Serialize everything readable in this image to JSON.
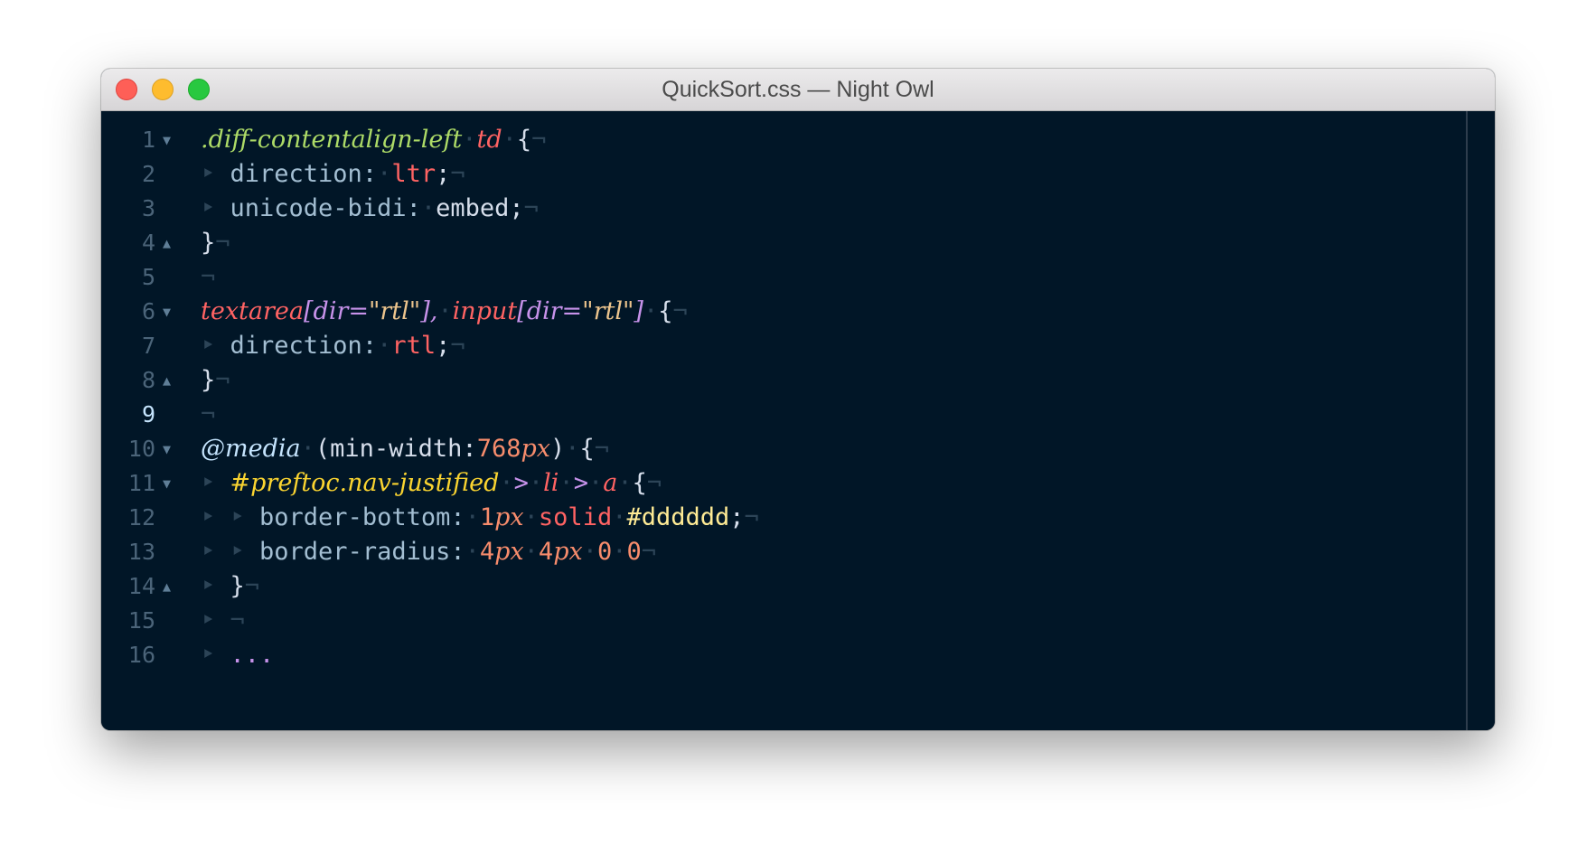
{
  "window": {
    "title": "QuickSort.css — Night Owl"
  },
  "colors": {
    "background": "#011627",
    "selector": "#addb67",
    "tag": "#ff6363",
    "attribute": "#c792ea",
    "number": "#f78c6c",
    "id_selector": "#fad430",
    "hex": "#ffeb95",
    "invisibles": "#2c4457"
  },
  "invisibles": {
    "eol": "¬",
    "tab": "‣"
  },
  "gutter": {
    "lines": [
      {
        "num": "1",
        "fold": "▼"
      },
      {
        "num": "2",
        "fold": ""
      },
      {
        "num": "3",
        "fold": ""
      },
      {
        "num": "4",
        "fold": "▲"
      },
      {
        "num": "5",
        "fold": ""
      },
      {
        "num": "6",
        "fold": "▼"
      },
      {
        "num": "7",
        "fold": ""
      },
      {
        "num": "8",
        "fold": "▲"
      },
      {
        "num": "9",
        "fold": ""
      },
      {
        "num": "10",
        "fold": "▼"
      },
      {
        "num": "11",
        "fold": "▼"
      },
      {
        "num": "12",
        "fold": ""
      },
      {
        "num": "13",
        "fold": ""
      },
      {
        "num": "14",
        "fold": "▲"
      },
      {
        "num": "15",
        "fold": ""
      },
      {
        "num": "16",
        "fold": ""
      }
    ],
    "active_line": "9"
  },
  "code": [
    [
      {
        "t": "sel",
        "v": ".diff-contentalign-left"
      },
      {
        "t": "inv",
        "v": "·"
      },
      {
        "t": "tag",
        "v": "td"
      },
      {
        "t": "inv",
        "v": "·"
      },
      {
        "t": "punc",
        "v": "{"
      },
      {
        "t": "inv",
        "v": "¬"
      }
    ],
    [
      {
        "t": "inv",
        "v": "‣ "
      },
      {
        "t": "prop",
        "v": "direction:"
      },
      {
        "t": "inv",
        "v": "·"
      },
      {
        "t": "val",
        "v": "ltr"
      },
      {
        "t": "punc",
        "v": ";"
      },
      {
        "t": "inv",
        "v": "¬"
      }
    ],
    [
      {
        "t": "inv",
        "v": "‣ "
      },
      {
        "t": "prop",
        "v": "unicode-bidi:"
      },
      {
        "t": "inv",
        "v": "·"
      },
      {
        "t": "plain",
        "v": "embed"
      },
      {
        "t": "punc",
        "v": ";"
      },
      {
        "t": "inv",
        "v": "¬"
      }
    ],
    [
      {
        "t": "punc",
        "v": "}"
      },
      {
        "t": "inv",
        "v": "¬"
      }
    ],
    [
      {
        "t": "inv",
        "v": "¬"
      }
    ],
    [
      {
        "t": "tag",
        "v": "textarea"
      },
      {
        "t": "attr",
        "v": "[dir="
      },
      {
        "t": "str",
        "v": "\"rtl\""
      },
      {
        "t": "attr",
        "v": "],"
      },
      {
        "t": "inv",
        "v": "·"
      },
      {
        "t": "tag",
        "v": "input"
      },
      {
        "t": "attr",
        "v": "[dir="
      },
      {
        "t": "str",
        "v": "\"rtl\""
      },
      {
        "t": "attr",
        "v": "]"
      },
      {
        "t": "inv",
        "v": "·"
      },
      {
        "t": "punc",
        "v": "{"
      },
      {
        "t": "inv",
        "v": "¬"
      }
    ],
    [
      {
        "t": "inv",
        "v": "‣ "
      },
      {
        "t": "prop",
        "v": "direction:"
      },
      {
        "t": "inv",
        "v": "·"
      },
      {
        "t": "val",
        "v": "rtl"
      },
      {
        "t": "punc",
        "v": ";"
      },
      {
        "t": "inv",
        "v": "¬"
      }
    ],
    [
      {
        "t": "punc",
        "v": "}"
      },
      {
        "t": "inv",
        "v": "¬"
      }
    ],
    [
      {
        "t": "inv",
        "v": "¬"
      }
    ],
    [
      {
        "t": "at",
        "v": "@media"
      },
      {
        "t": "inv",
        "v": "·"
      },
      {
        "t": "plain",
        "v": "(min-width:"
      },
      {
        "t": "num",
        "v": "768"
      },
      {
        "t": "unit",
        "v": "px"
      },
      {
        "t": "plain",
        "v": ")"
      },
      {
        "t": "inv",
        "v": "·"
      },
      {
        "t": "punc",
        "v": "{"
      },
      {
        "t": "inv",
        "v": "¬"
      }
    ],
    [
      {
        "t": "inv",
        "v": "‣ "
      },
      {
        "t": "id",
        "v": "#preftoc.nav-justified"
      },
      {
        "t": "inv",
        "v": "·"
      },
      {
        "t": "comb",
        "v": ">"
      },
      {
        "t": "inv",
        "v": "·"
      },
      {
        "t": "tag",
        "v": "li"
      },
      {
        "t": "inv",
        "v": "·"
      },
      {
        "t": "comb",
        "v": ">"
      },
      {
        "t": "inv",
        "v": "·"
      },
      {
        "t": "tag",
        "v": "a"
      },
      {
        "t": "inv",
        "v": "·"
      },
      {
        "t": "punc",
        "v": "{"
      },
      {
        "t": "inv",
        "v": "¬"
      }
    ],
    [
      {
        "t": "inv",
        "v": "‣ ‣ "
      },
      {
        "t": "prop",
        "v": "border-bottom:"
      },
      {
        "t": "inv",
        "v": "·"
      },
      {
        "t": "num",
        "v": "1"
      },
      {
        "t": "unit",
        "v": "px"
      },
      {
        "t": "inv",
        "v": "·"
      },
      {
        "t": "val",
        "v": "solid"
      },
      {
        "t": "inv",
        "v": "·"
      },
      {
        "t": "hex",
        "v": "#dddddd"
      },
      {
        "t": "punc",
        "v": ";"
      },
      {
        "t": "inv",
        "v": "¬"
      }
    ],
    [
      {
        "t": "inv",
        "v": "‣ ‣ "
      },
      {
        "t": "prop",
        "v": "border-radius:"
      },
      {
        "t": "inv",
        "v": "·"
      },
      {
        "t": "num",
        "v": "4"
      },
      {
        "t": "unit",
        "v": "px"
      },
      {
        "t": "inv",
        "v": "·"
      },
      {
        "t": "num",
        "v": "4"
      },
      {
        "t": "unit",
        "v": "px"
      },
      {
        "t": "inv",
        "v": "·"
      },
      {
        "t": "num",
        "v": "0"
      },
      {
        "t": "inv",
        "v": "·"
      },
      {
        "t": "num",
        "v": "0"
      },
      {
        "t": "inv",
        "v": "¬"
      }
    ],
    [
      {
        "t": "inv",
        "v": "‣ "
      },
      {
        "t": "punc",
        "v": "}"
      },
      {
        "t": "inv",
        "v": "¬"
      }
    ],
    [
      {
        "t": "inv",
        "v": "‣ "
      },
      {
        "t": "inv",
        "v": "¬"
      }
    ],
    [
      {
        "t": "inv",
        "v": "‣ "
      },
      {
        "t": "dots",
        "v": "..."
      }
    ]
  ]
}
